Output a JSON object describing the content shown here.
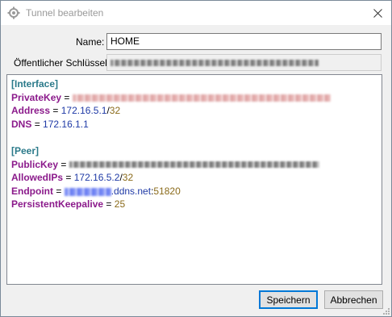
{
  "window": {
    "title": "Tunnel bearbeiten"
  },
  "form": {
    "name_label": "Name:",
    "name_value": "HOME",
    "pubkey_label": "Öffentlicher Schlüssel:"
  },
  "config": {
    "interface_header": "[Interface]",
    "private_key_label": "PrivateKey",
    "address_label": "Address",
    "address_ip": "172.16.5.1",
    "address_prefix": "32",
    "dns_label": "DNS",
    "dns_value": "172.16.1.1",
    "peer_header": "[Peer]",
    "public_key_label": "PublicKey",
    "allowed_ips_label": "AllowedIPs",
    "allowed_ips_ip": "172.16.5.2",
    "allowed_ips_prefix": "32",
    "endpoint_label": "Endpoint",
    "endpoint_domain": ".ddns.net",
    "endpoint_port": "51820",
    "keepalive_label": "PersistentKeepalive",
    "keepalive_value": "25",
    "eq": "=",
    "slash": "/",
    "colon": ":"
  },
  "buttons": {
    "save": "Speichern",
    "cancel": "Abbrechen"
  },
  "colors": {
    "section": "#2b7a8a",
    "key": "#8b1a8b",
    "value": "#1f3aa6",
    "number": "#8a6a1a",
    "accent": "#0078d7"
  }
}
